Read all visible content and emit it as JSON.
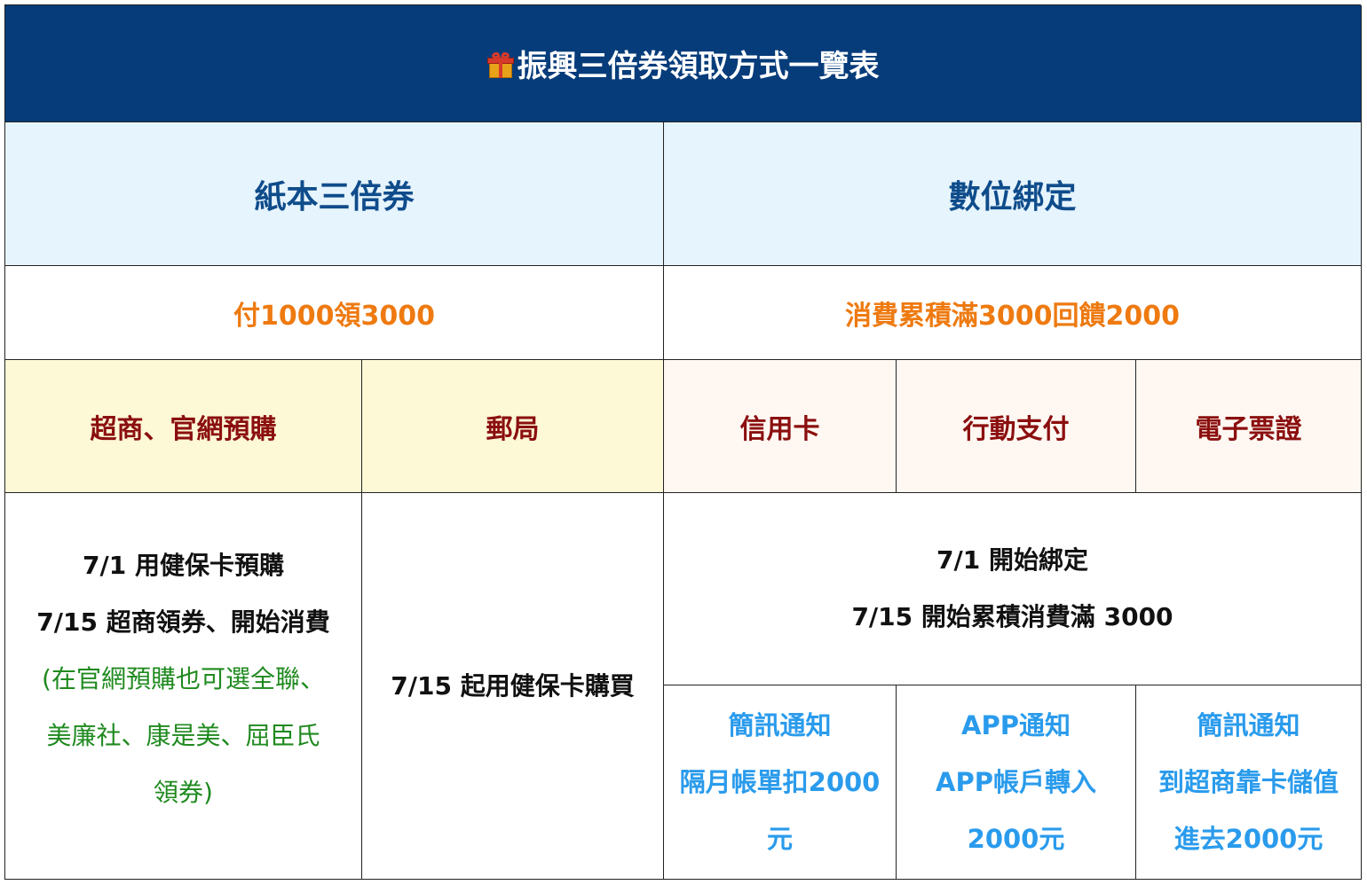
{
  "title": "振興三倍券領取方式一覽表",
  "title_icon": "gift-icon",
  "columns": {
    "paper": {
      "heading": "紙本三倍券",
      "offer": "付1000領3000",
      "methods": [
        "超商、官網預購",
        "郵局"
      ],
      "store_steps": {
        "line1": "7/1 用健保卡預購",
        "line2": "7/15 超商領券、開始消費",
        "note_line1": "(在官網預購也可選全聯、",
        "note_line2": "美廉社、康是美、屈臣氏",
        "note_line3": "領券)"
      },
      "post_steps": "7/15 起用健保卡購買"
    },
    "digital": {
      "heading": "數位綁定",
      "offer": "消費累積滿3000回饋2000",
      "methods": [
        "信用卡",
        "行動支付",
        "電子票證"
      ],
      "steps": {
        "line1": "7/1 開始綁定",
        "line2": "7/15 開始累積消費滿 3000"
      },
      "refunds": [
        {
          "line1": "簡訊通知",
          "line2": "隔月帳單扣2000",
          "line3": "元"
        },
        {
          "line1": "APP通知",
          "line2": "APP帳戶轉入",
          "line3": "2000元"
        },
        {
          "line1": "簡訊通知",
          "line2": "到超商靠卡儲值",
          "line3": "進去2000元"
        }
      ]
    }
  },
  "colors": {
    "title_bg": "#063c7a",
    "heading_text": "#0f4c8b",
    "heading_bg": "#e6f4fd",
    "offer_text": "#ee7a10",
    "method_text": "#8b0f0f",
    "note_text": "#1f8a1f",
    "refund_text": "#2a9bec"
  }
}
